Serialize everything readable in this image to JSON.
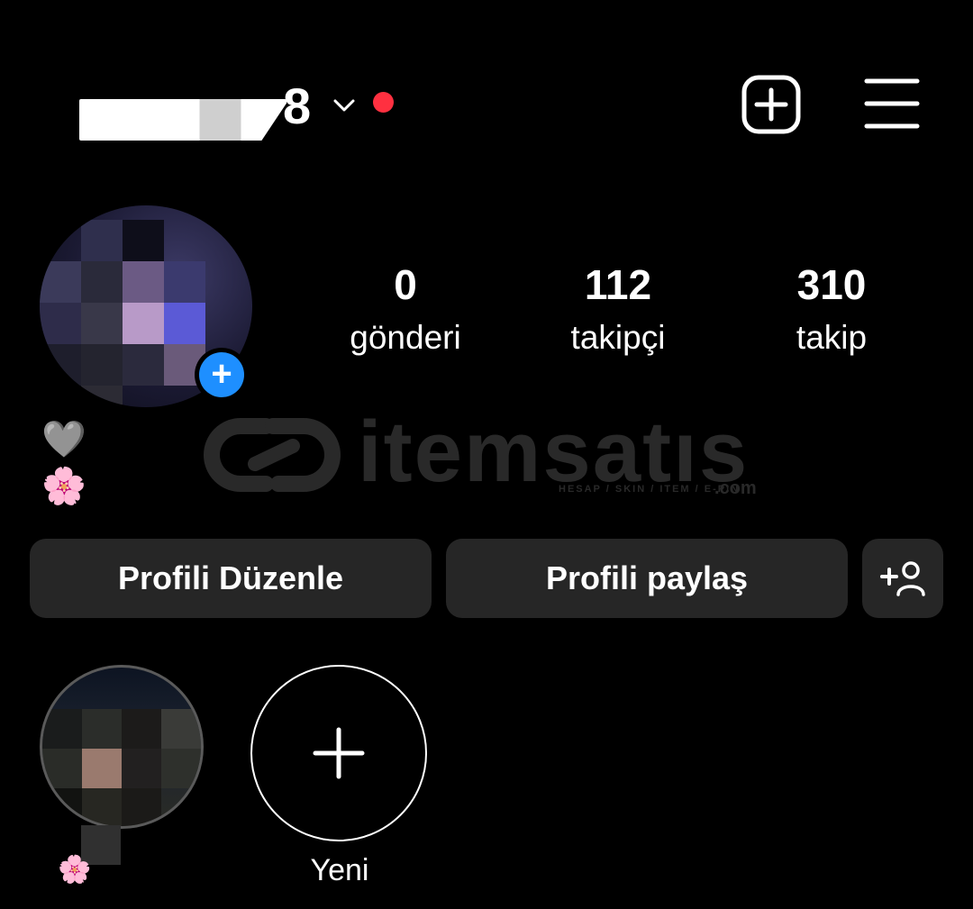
{
  "header": {
    "username_visible": "8",
    "username_icon": "chevron-down-icon",
    "notification_dot_color": "#ff3040",
    "create_icon": "plus-square-icon",
    "menu_icon": "hamburger-menu-icon"
  },
  "profile": {
    "avatar_badge_icon": "plus-icon",
    "avatar_badge_color": "#1e8fff",
    "stats": [
      {
        "count": "0",
        "label": "gönderi"
      },
      {
        "count": "112",
        "label": "takipçi"
      },
      {
        "count": "310",
        "label": "takip"
      }
    ],
    "bio": [
      "🩶",
      "🌸"
    ]
  },
  "watermark": {
    "brand": "itemsatıs",
    "tagline": "HESAP / SKIN / ITEM / E-PIN",
    "domain": ".com"
  },
  "actions": {
    "edit_profile": "Profili Düzenle",
    "share_profile": "Profili paylaş",
    "discover_people_icon": "add-person-icon"
  },
  "highlights": {
    "existing_emoji": "🌸",
    "new_label": "Yeni"
  },
  "colors": {
    "background": "#000000",
    "button_bg": "#262626",
    "text": "#ffffff"
  }
}
